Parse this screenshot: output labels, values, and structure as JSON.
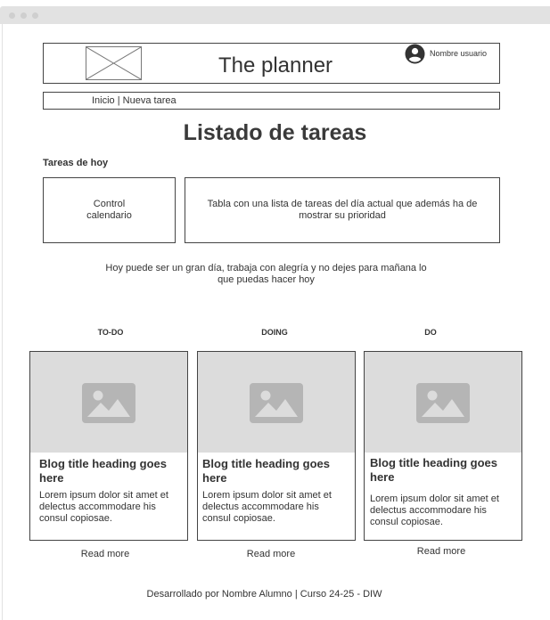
{
  "header": {
    "site_title": "The planner",
    "user_name": "Nombre usuario",
    "user_icon": "user-avatar-icon",
    "logo_icon": "image-placeholder-icon"
  },
  "nav": {
    "items": [
      {
        "label": "Inicio"
      },
      {
        "label": "Nueva tarea"
      }
    ],
    "separator": " | "
  },
  "main": {
    "page_title": "Listado de tareas",
    "section_title": "Tareas de hoy",
    "calendar_widget_text": "Control calendario",
    "tasks_table_text": "Tabla con una lista de tareas del día actual que además ha de mostrar su prioridad",
    "motto": "Hoy puede ser un gran día, trabaja con alegría y no dejes para mañana lo que puedas hacer hoy"
  },
  "columns": [
    {
      "heading": "TO-DO",
      "card_title": "Blog title heading goes here",
      "card_body": "Lorem ipsum dolor sit amet et delectus accommodare his consul copiosae.",
      "read_more": "Read more",
      "image_icon": "image-placeholder-icon"
    },
    {
      "heading": "DOING",
      "card_title": "Blog title heading goes here",
      "card_body": "Lorem ipsum dolor sit amet et delectus accommodare his consul copiosae.",
      "read_more": "Read more",
      "image_icon": "image-placeholder-icon"
    },
    {
      "heading": "DO",
      "card_title": "Blog title heading goes here",
      "card_body": "Lorem ipsum dolor sit amet et delectus accommodare his consul copiosae.",
      "read_more": "Read more",
      "image_icon": "image-placeholder-icon"
    }
  ],
  "footer": {
    "text": "Desarrollado por Nombre Alumno | Curso 24-25 - DIW"
  },
  "colors": {
    "text": "#333333",
    "border": "#444444",
    "placeholder_bg": "#dcdcdc",
    "placeholder_icon": "#b5b5b5",
    "chrome_bar": "#e2e2e2"
  }
}
